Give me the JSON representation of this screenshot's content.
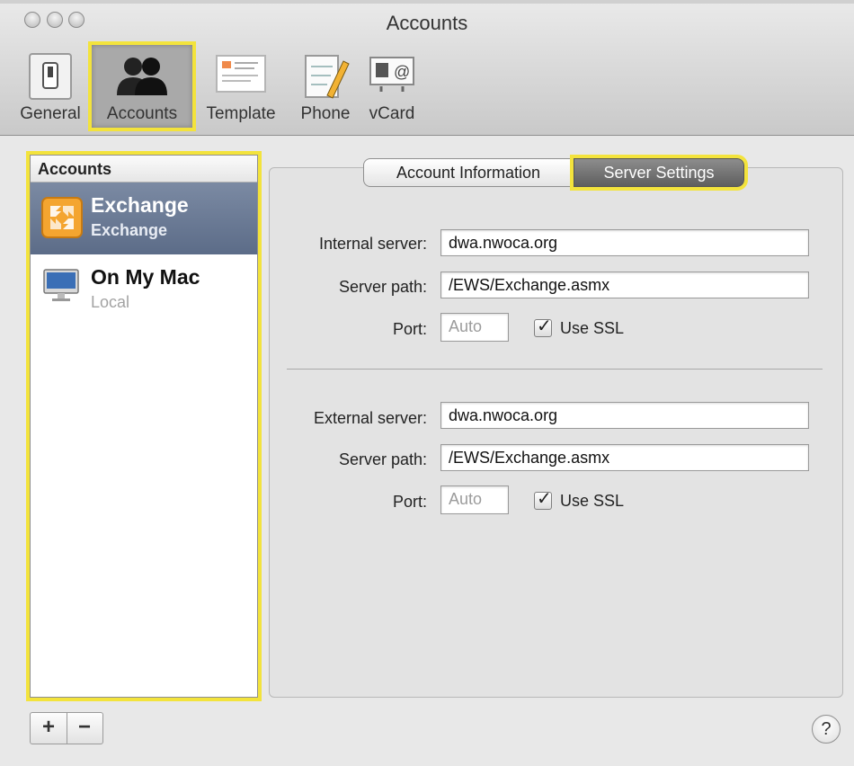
{
  "window": {
    "title": "Accounts"
  },
  "toolbar": {
    "general": "General",
    "accounts": "Accounts",
    "template": "Template",
    "phone": "Phone",
    "vcard": "vCard"
  },
  "sidebar": {
    "header": "Accounts",
    "items": [
      {
        "name": "Exchange",
        "type": "Exchange",
        "selected": true
      },
      {
        "name": "On My Mac",
        "type": "Local",
        "selected": false
      }
    ]
  },
  "tabs": {
    "account_information": "Account Information",
    "server_settings": "Server Settings",
    "selected": "Server Settings"
  },
  "internal": {
    "server_label": "Internal server:",
    "server_value": "dwa.nwoca.org",
    "path_label": "Server path:",
    "path_value": "/EWS/Exchange.asmx",
    "port_label": "Port:",
    "port_placeholder": "Auto",
    "ssl_label": "Use SSL",
    "ssl_checked": true
  },
  "external": {
    "server_label": "External server:",
    "server_value": "dwa.nwoca.org",
    "path_label": "Server path:",
    "path_value": "/EWS/Exchange.asmx",
    "port_label": "Port:",
    "port_placeholder": "Auto",
    "ssl_label": "Use SSL",
    "ssl_checked": true
  },
  "bottom": {
    "add": "+",
    "remove": "−",
    "help": "?"
  },
  "colors": {
    "highlight": "#f3e33c",
    "selection": "#5c6c88"
  }
}
